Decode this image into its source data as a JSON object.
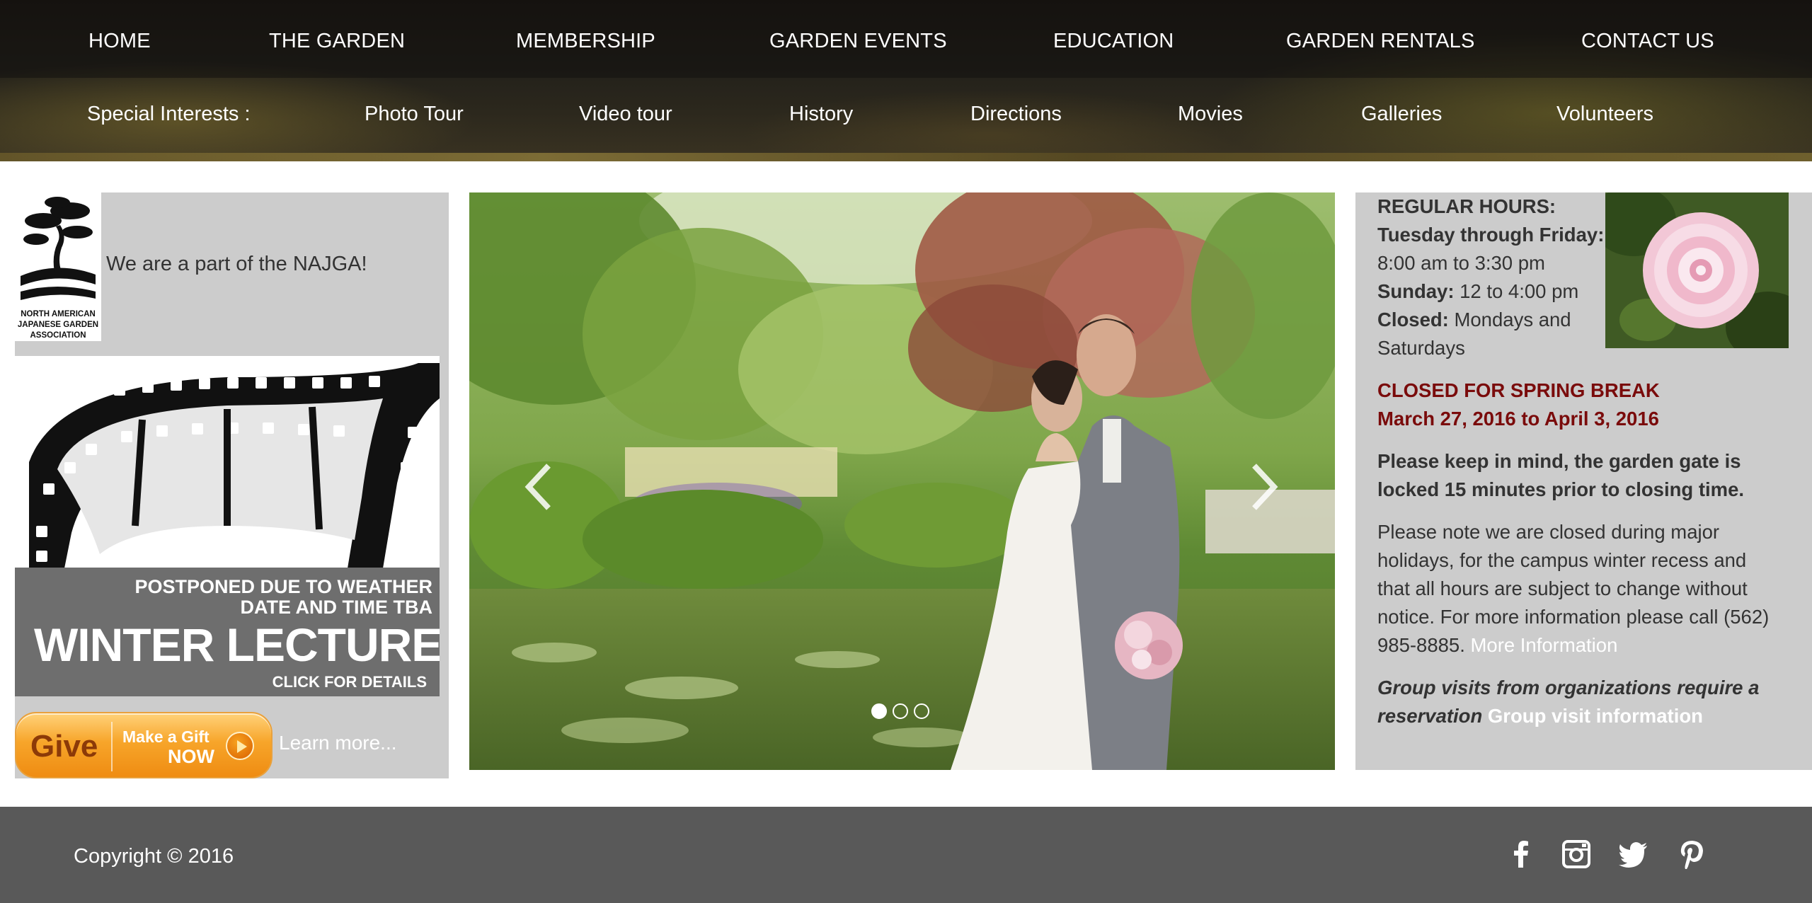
{
  "main_nav": [
    {
      "label": "HOME"
    },
    {
      "label": "THE GARDEN"
    },
    {
      "label": "MEMBERSHIP"
    },
    {
      "label": "GARDEN EVENTS"
    },
    {
      "label": "EDUCATION"
    },
    {
      "label": "GARDEN RENTALS"
    },
    {
      "label": "CONTACT US"
    }
  ],
  "sub_nav": {
    "heading": "Special Interests :",
    "items": [
      {
        "label": "Photo Tour"
      },
      {
        "label": "Video tour"
      },
      {
        "label": "History"
      },
      {
        "label": "Directions"
      },
      {
        "label": "Movies"
      },
      {
        "label": "Galleries"
      },
      {
        "label": "Volunteers"
      }
    ]
  },
  "left": {
    "logo_text": [
      "NORTH AMERICAN",
      "JAPANESE GARDEN",
      "ASSOCIATION"
    ],
    "najga_text": "We are a part of the NAJGA!",
    "lecture": {
      "line1": "POSTPONED DUE TO WEATHER",
      "line2": "DATE AND TIME TBA",
      "line3": "WINTER LECTURE",
      "line4": "CLICK FOR DETAILS"
    },
    "give": {
      "give_label": "Give",
      "make_label": "Make a Gift",
      "now_label": "NOW"
    },
    "learn_more": "Learn more..."
  },
  "carousel": {
    "slides": 3,
    "active_slide": 1,
    "prev_icon": "chevron-left-icon",
    "next_icon": "chevron-right-icon"
  },
  "right": {
    "hours_title": "REGULAR HOURS:",
    "weekday_label": "Tuesday through Friday:",
    "weekday_hours": "8:00 am to 3:30 pm",
    "sunday_label": "Sunday:",
    "sunday_hours": " 12 to 4:00 pm",
    "closed_label": "Closed:",
    "closed_days_1": " Mondays and",
    "closed_days_2": "Saturdays",
    "spring_break_1": "CLOSED FOR SPRING BREAK",
    "spring_break_2": "March 27, 2016 to April 3, 2016",
    "gate_note_1": "Please keep in mind, the garden gate is",
    "gate_note_2": "locked 15 minutes prior to closing time.",
    "holiday_1": "Please note we are closed during major",
    "holiday_2": "holidays, for the campus winter recess and",
    "holiday_3": "that all hours are subject to change without",
    "holiday_4": "notice. For more information please call (562)",
    "holiday_5": "985-8885.",
    "more_info_link": " More Information",
    "group_1": "Group visits from organizations require a",
    "group_2": "reservation",
    "group_link": " Group visit information"
  },
  "footer": {
    "copyright": "Copyright © 2016",
    "social": [
      "facebook-icon",
      "instagram-icon",
      "twitter-icon",
      "pinterest-icon"
    ]
  },
  "colors": {
    "sidebar_bg": "#cccccc",
    "footer_bg": "#595959",
    "alert_red": "#7a0b0b",
    "give_orange": "#f7a52a"
  }
}
